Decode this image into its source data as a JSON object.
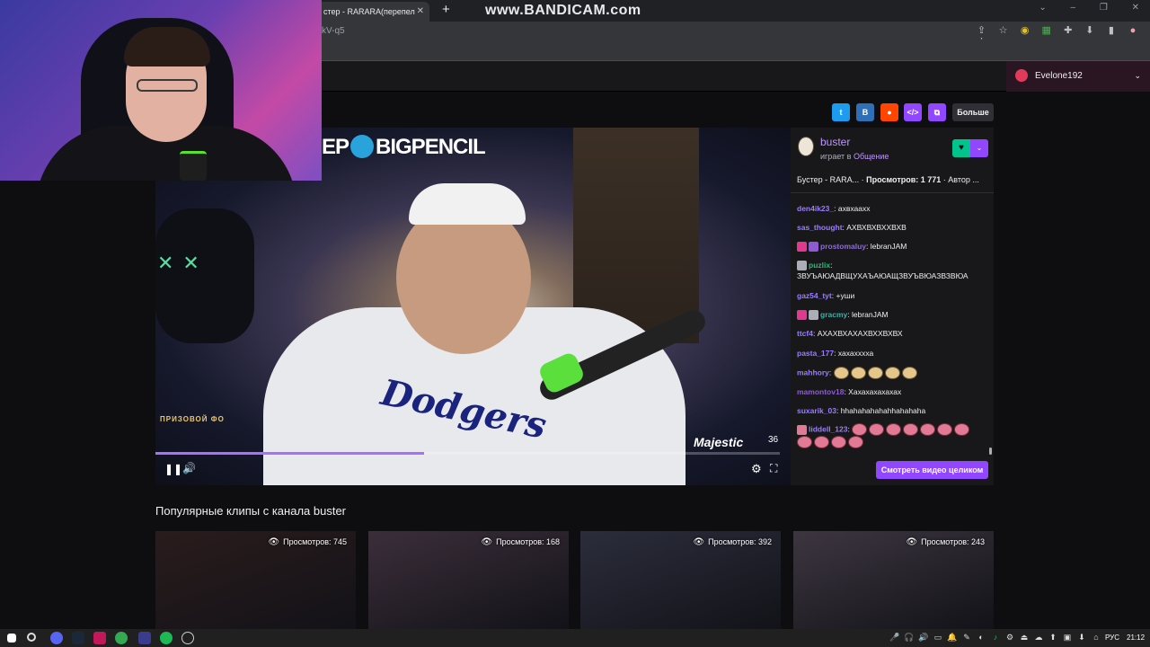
{
  "browser": {
    "tab_title": "стер - RARARA(перепел",
    "tab_close": "✕",
    "new_tab": "+",
    "watermark": "www.BANDICAM.com",
    "url": "kV-q5",
    "window_controls": [
      "⌄",
      "–",
      "❐",
      "✕"
    ]
  },
  "twitch": {
    "user_name": "Evelone192",
    "user_caret": "⌄",
    "share": {
      "more_label": "Больше",
      "buttons": [
        {
          "name": "twitter",
          "glyph": "t",
          "color": "#1d9bf0"
        },
        {
          "name": "vk",
          "glyph": "B",
          "color": "#2f6fb5"
        },
        {
          "name": "reddit",
          "glyph": "●",
          "color": "#ff4500"
        },
        {
          "name": "embed",
          "glyph": "</>",
          "color": "#9147ff"
        },
        {
          "name": "copy",
          "glyph": "⧉",
          "color": "#9147ff"
        }
      ]
    }
  },
  "video": {
    "overlay_banner_left": "EP",
    "overlay_banner_right": "BIGPENCIL",
    "overlay_bottom_left": "ПРИЗОВОЙ ФО",
    "overlay_logo": "Majestic",
    "overlay_logo_note": "⊲",
    "timer": "36",
    "progress": 0.43,
    "play_icon": "❚❚",
    "volume_icon": "🔊",
    "settings_icon": "⚙",
    "fullscreen_icon": "⛶"
  },
  "channel": {
    "name": "buster",
    "playing_prefix": "играет в",
    "category": "Общение",
    "follow_icon": "♥",
    "sub_icon": "⌄",
    "clip_title": "Бустер - RARA...",
    "views_label": "Просмотров: 1 771",
    "author_label": "Автор ..."
  },
  "chat": {
    "messages": [
      {
        "user": "den4ik23_",
        "user_color": "#9a7dff",
        "text": "ахвхаахх",
        "badges": []
      },
      {
        "user": "sas_thought",
        "user_color": "#9a7dff",
        "text": "АХВХВХВХХВХВ",
        "badges": []
      },
      {
        "user": "prostomaluy",
        "user_color": "#8e6cd6",
        "text": "lebranJAM",
        "badges": [
          "#e0398f",
          "#8e5cd0"
        ]
      },
      {
        "user": "puzlix",
        "user_color": "#2fb57a",
        "text": "ЗВУЪАЮАДВЩУХАЪАЮАЩЗВУЪВЮАЗВЗВЮА",
        "badges": [
          "#adadb8"
        ]
      },
      {
        "user": "gaz54_tyt",
        "user_color": "#9a7dff",
        "text": "+уши",
        "badges": []
      },
      {
        "user": "gracmy",
        "user_color": "#2fb5a8",
        "text": "lebranJAM",
        "badges": [
          "#e0398f",
          "#adadb8"
        ]
      },
      {
        "user": "ttcf4",
        "user_color": "#9a7dff",
        "text": "АХАХВХАХАХВХХВХВХ",
        "badges": []
      },
      {
        "user": "pasta_177",
        "user_color": "#9a7dff",
        "text": "хахахххха",
        "badges": []
      },
      {
        "user": "mahhory",
        "user_color": "#9a7dff",
        "text": "",
        "badges": [],
        "emotes": 5
      },
      {
        "user": "mamontov18",
        "user_color": "#8e5cd0",
        "text": "Хахахахахахах",
        "badges": []
      },
      {
        "user": "suxarik_03",
        "user_color": "#9a7dff",
        "text": "hhahahahahahhahahaha",
        "badges": []
      },
      {
        "user": "liddell_123",
        "user_color": "#9a7dff",
        "text": "",
        "badges": [
          "#e27a96"
        ],
        "emotes": 11,
        "emote_style": "pink"
      }
    ],
    "watch_button": "Смотреть видео целиком"
  },
  "clips": {
    "section_title": "Популярные клипы с канала buster",
    "items": [
      {
        "views": "Просмотров: 745",
        "bg": "#2a1c1c"
      },
      {
        "views": "Просмотров: 168",
        "bg": "#3b2e3a"
      },
      {
        "views": "Просмотров: 392",
        "bg": "#2c2d3c"
      },
      {
        "views": "Просмотров: 243",
        "bg": "#3d3640"
      }
    ]
  },
  "taskbar": {
    "lang": "РУС",
    "time": "21:12",
    "tray_icons": [
      "🎤",
      "🎧",
      "🔊",
      "▭",
      "🔔",
      "✎",
      "◐",
      "♪",
      "⚙",
      "⏏",
      "☁",
      "⬆",
      "▣",
      "⬇",
      "⌂"
    ]
  }
}
